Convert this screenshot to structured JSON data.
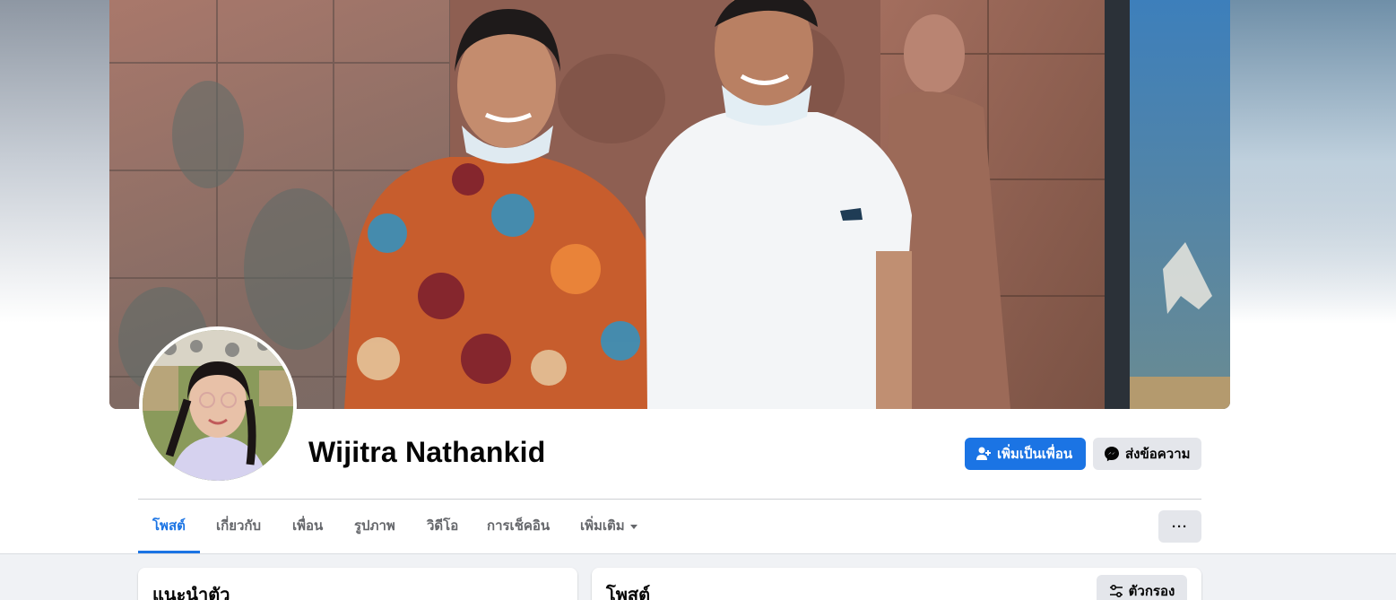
{
  "profile": {
    "name": "Wijitra Nathankid",
    "add_friend_label": "เพิ่มเป็นเพื่อน",
    "message_label": "ส่งข้อความ",
    "more_label": "···"
  },
  "tabs": [
    {
      "label": "โพสต์",
      "active": true
    },
    {
      "label": "เกี่ยวกับ",
      "active": false
    },
    {
      "label": "เพื่อน",
      "active": false
    },
    {
      "label": "รูปภาพ",
      "active": false
    },
    {
      "label": "วิดีโอ",
      "active": false
    },
    {
      "label": "การเช็คอิน",
      "active": false
    },
    {
      "label": "เพิ่มเติม",
      "active": false
    }
  ],
  "intro": {
    "title": "แนะนำตัว"
  },
  "posts": {
    "title": "โพสต์",
    "filter_label": "ตัวกรอง"
  },
  "colors": {
    "accent": "#1b74e4",
    "button_gray": "#e4e6eb",
    "text_primary": "#050505",
    "text_secondary": "#65676b"
  },
  "icons": {
    "add_friend": "person-add-icon",
    "message": "messenger-icon",
    "more": "more-dots-icon",
    "filter": "filter-sliders-icon",
    "more_tab": "caret-down-icon"
  }
}
